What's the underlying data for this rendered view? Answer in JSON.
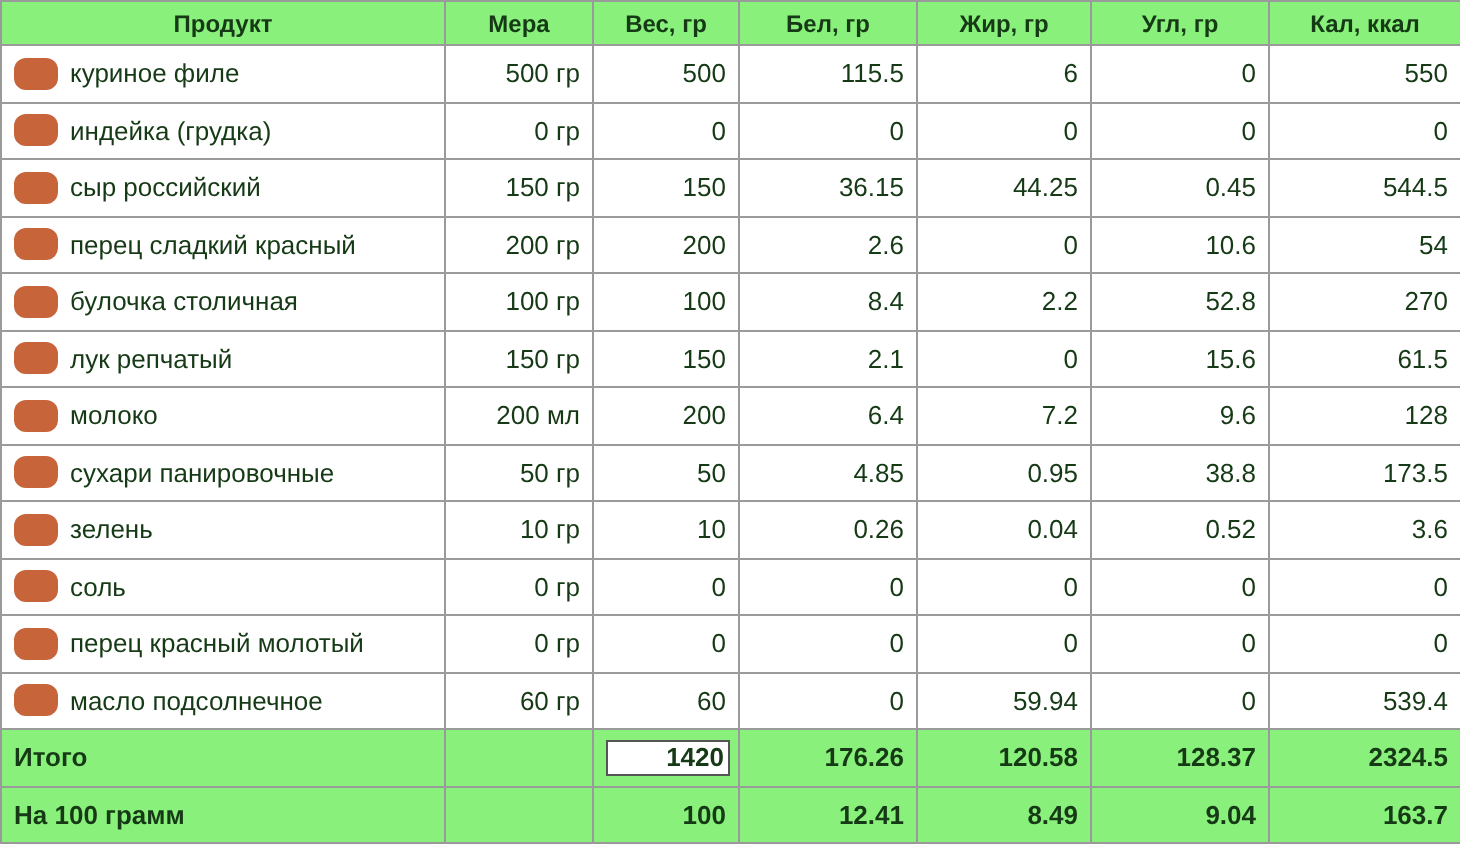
{
  "table": {
    "columns": [
      "Продукт",
      "Мера",
      "Вес, гр",
      "Бел, гр",
      "Жир, гр",
      "Угл, гр",
      "Кал, ккал"
    ],
    "rows": [
      {
        "product": "куриное филе",
        "measure": "500 гр",
        "weight": "500",
        "protein": "115.5",
        "fat": "6",
        "carbs": "0",
        "kcal": "550"
      },
      {
        "product": "индейка (грудка)",
        "measure": "0 гр",
        "weight": "0",
        "protein": "0",
        "fat": "0",
        "carbs": "0",
        "kcal": "0"
      },
      {
        "product": "сыр российский",
        "measure": "150 гр",
        "weight": "150",
        "protein": "36.15",
        "fat": "44.25",
        "carbs": "0.45",
        "kcal": "544.5"
      },
      {
        "product": "перец сладкий красный",
        "measure": "200 гр",
        "weight": "200",
        "protein": "2.6",
        "fat": "0",
        "carbs": "10.6",
        "kcal": "54"
      },
      {
        "product": "булочка столичная",
        "measure": "100 гр",
        "weight": "100",
        "protein": "8.4",
        "fat": "2.2",
        "carbs": "52.8",
        "kcal": "270"
      },
      {
        "product": "лук репчатый",
        "measure": "150 гр",
        "weight": "150",
        "protein": "2.1",
        "fat": "0",
        "carbs": "15.6",
        "kcal": "61.5"
      },
      {
        "product": "молоко",
        "measure": "200 мл",
        "weight": "200",
        "protein": "6.4",
        "fat": "7.2",
        "carbs": "9.6",
        "kcal": "128"
      },
      {
        "product": "сухари панировочные",
        "measure": "50 гр",
        "weight": "50",
        "protein": "4.85",
        "fat": "0.95",
        "carbs": "38.8",
        "kcal": "173.5"
      },
      {
        "product": "зелень",
        "measure": "10 гр",
        "weight": "10",
        "protein": "0.26",
        "fat": "0.04",
        "carbs": "0.52",
        "kcal": "3.6"
      },
      {
        "product": "соль",
        "measure": "0 гр",
        "weight": "0",
        "protein": "0",
        "fat": "0",
        "carbs": "0",
        "kcal": "0"
      },
      {
        "product": "перец красный молотый",
        "measure": "0 гр",
        "weight": "0",
        "protein": "0",
        "fat": "0",
        "carbs": "0",
        "kcal": "0"
      },
      {
        "product": "масло подсолнечное",
        "measure": "60 гр",
        "weight": "60",
        "protein": "0",
        "fat": "59.94",
        "carbs": "0",
        "kcal": "539.4"
      }
    ],
    "summary": [
      {
        "kind": "field",
        "label": "Итого",
        "weight": "1420",
        "protein": "176.26",
        "fat": "120.58",
        "carbs": "128.37",
        "kcal": "2324.5"
      },
      {
        "kind": "text",
        "label": "На 100 грамм",
        "weight": "100",
        "protein": "12.41",
        "fat": "8.49",
        "carbs": "9.04",
        "kcal": "163.7"
      }
    ]
  }
}
